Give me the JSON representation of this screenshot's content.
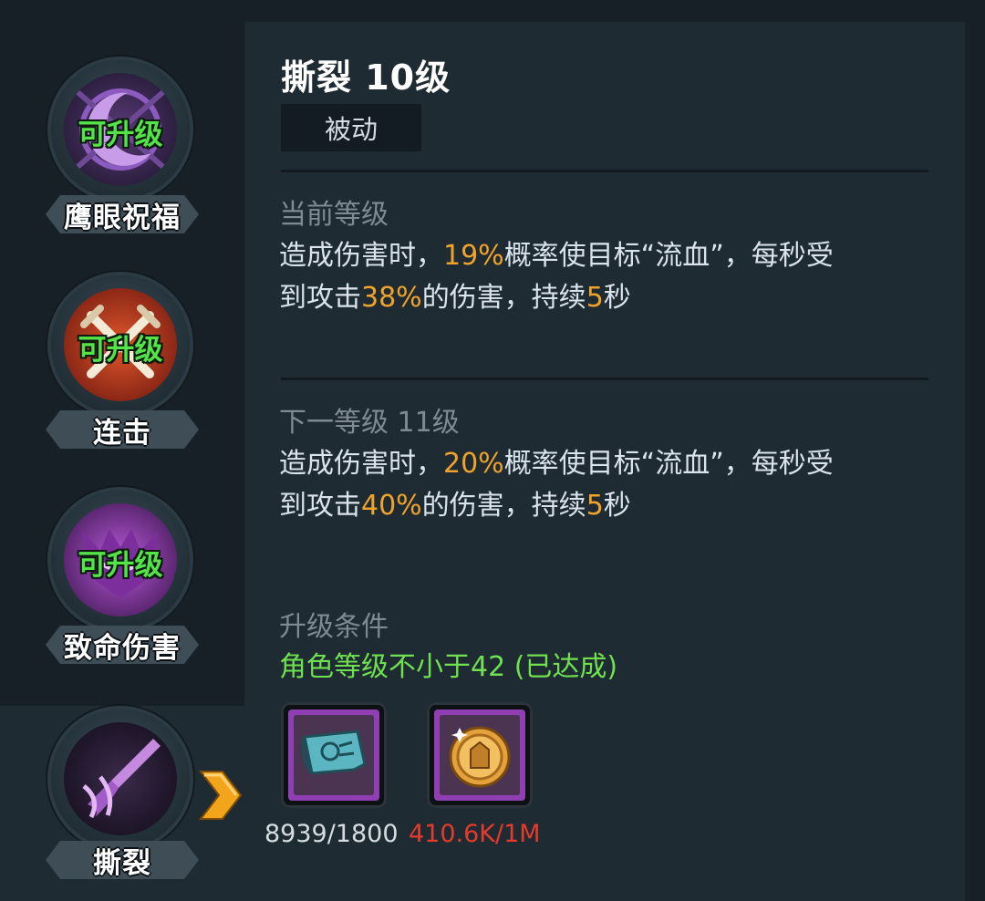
{
  "skills": [
    {
      "name": "鹰眼祝福",
      "badge": "可升级"
    },
    {
      "name": "连击",
      "badge": "可升级"
    },
    {
      "name": "致命伤害",
      "badge": "可升级"
    },
    {
      "name": "撕裂",
      "badge": ""
    }
  ],
  "detail": {
    "title": "撕裂 10级",
    "type_tag": "被动",
    "current": {
      "label": "当前等级",
      "line1_a": "造成伤害时，",
      "line1_hl": "19%",
      "line1_b": "概率使目标“流血”，每秒受",
      "line2_a": "到攻击",
      "line2_hl": "38%",
      "line2_b": "的伤害，持续",
      "line2_hl2": "5",
      "line2_c": "秒"
    },
    "next": {
      "label": "下一等级 11级",
      "line1_a": "造成伤害时，",
      "line1_hl": "20%",
      "line1_b": "概率使目标“流血”，每秒受",
      "line2_a": "到攻击",
      "line2_hl": "40%",
      "line2_b": "的伤害，持续",
      "line2_hl2": "5",
      "line2_c": "秒"
    },
    "upgrade": {
      "label": "升级条件",
      "requirement": "角色等级不小于42 (已达成)"
    },
    "costs": [
      {
        "icon": "scroll-icon",
        "amount": "8939/1800",
        "color": "#d6dde2"
      },
      {
        "icon": "gold-coin-icon",
        "amount": "410.6K/1M",
        "color": "#e53a2c"
      }
    ]
  },
  "colors": {
    "highlight": "#f0a32a",
    "available": "#55e34a",
    "requirement_met": "#6fe04f",
    "insufficient": "#e53a2c"
  }
}
